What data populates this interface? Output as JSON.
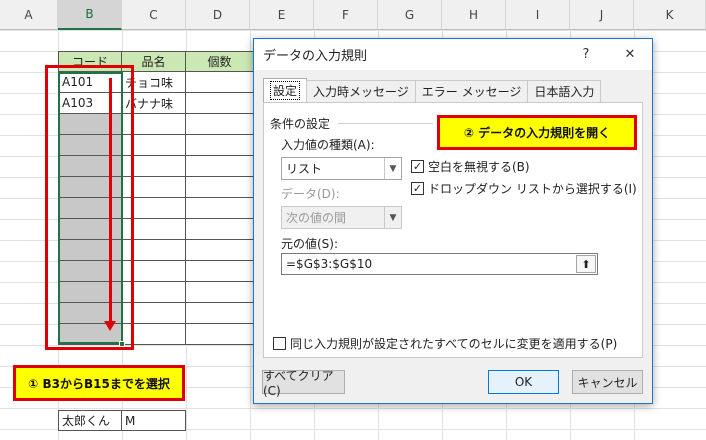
{
  "sheet": {
    "columns": [
      "A",
      "B",
      "C",
      "D",
      "E",
      "F",
      "G",
      "H",
      "I",
      "J",
      "K"
    ],
    "header_row": {
      "code": "コード",
      "name": "品名",
      "qty": "個数"
    },
    "rows": [
      {
        "code": "A101",
        "name": "チョコ味"
      },
      {
        "code": "A103",
        "name": "バナナ味"
      }
    ],
    "bottom_row": {
      "name": "太郎くん",
      "value": "M"
    }
  },
  "dialog": {
    "title": "データの入力規則",
    "help": "?",
    "close": "✕",
    "tabs": [
      "設定",
      "入力時メッセージ",
      "エラー メッセージ",
      "日本語入力"
    ],
    "section_title": "条件の設定",
    "allow_label": "入力値の種類(A):",
    "allow_value": "リスト",
    "data_label": "データ(D):",
    "data_value": "次の値の間",
    "ignore_blank": "空白を無視する(B)",
    "in_cell_dropdown": "ドロップダウン リストから選択する(I)",
    "source_label": "元の値(S):",
    "source_value": "=$G$3:$G$10",
    "apply_all": "同じ入力規則が設定されたすべてのセルに変更を適用する(P)",
    "clear_all": "すべてクリア(C)",
    "ok": "OK",
    "cancel": "キャンセル"
  },
  "callouts": {
    "step1": "① B3からB15までを選択",
    "step2": "② データの入力規則を開く"
  },
  "colors": {
    "header_green": "#cbe7b4",
    "selection_gray": "#c8c8c8",
    "callout_red": "#e00000",
    "callout_yellow": "#ffff00"
  }
}
